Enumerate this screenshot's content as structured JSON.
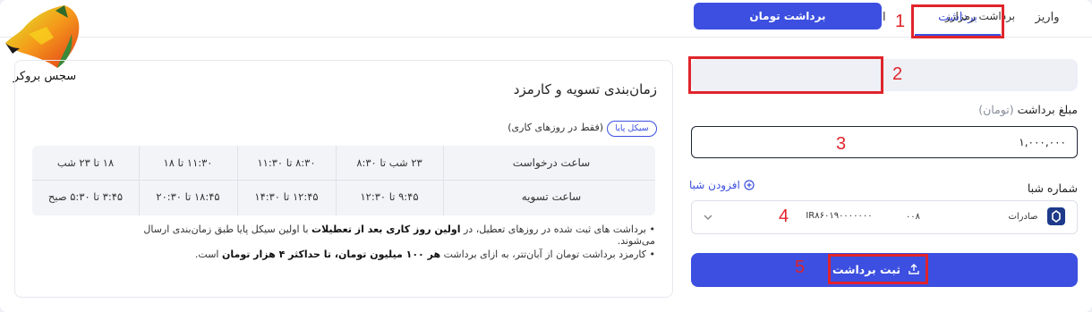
{
  "tabs": {
    "deposit": "واریز",
    "withdraw": "برداشت",
    "transfer": "انتقال"
  },
  "brand": {
    "logo_text": "سجس بروکر"
  },
  "annotations": [
    "1",
    "2",
    "3",
    "4",
    "5"
  ],
  "withdraw_form": {
    "segment_crypto": "برداشت رمزارز",
    "segment_toman": "برداشت تومان",
    "amount_label": "مبلغ برداشت",
    "amount_unit": "(تومان)",
    "amount_value": "۱,۰۰۰,۰۰۰",
    "sheba_label": "شماره شبا",
    "add_sheba": "افزودن شبا",
    "bank_name": "صادرات",
    "sheba_prefix": "۰۰۸",
    "sheba_number": "IR۸۶۰۱۹۰۰۰۰۰۰۰",
    "submit_label": "ثبت برداشت"
  },
  "schedule": {
    "title": "زمان‌بندی تسویه و کارمزد",
    "chip": "سیکل پایا",
    "chip_note": "(فقط در روزهای کاری)",
    "row_request_label": "ساعت درخواست",
    "row_settle_label": "ساعت تسویه",
    "request_times": [
      "۲۳ شب تا ۸:۳۰",
      "۸:۳۰ تا ۱۱:۳۰",
      "۱۱:۳۰ تا ۱۸",
      "۱۸ تا ۲۳ شب"
    ],
    "settle_times": [
      "۹:۴۵ تا ۱۲:۳۰",
      "۱۲:۴۵ تا ۱۴:۳۰",
      "۱۸:۴۵ تا ۲۰:۳۰",
      "۳:۴۵ تا ۵:۳۰ صبح"
    ],
    "note1_a": "برداشت های ثبت شده در روزهای تعطیل، در ",
    "note1_b": "اولین روز کاری بعد از تعطیلات",
    "note1_c": " با اولین سیکل پایا طبق زمان‌بندی ارسال می‌شوند.",
    "note2_a": "کارمزد برداشت تومان از آبان‌تتر، به ازای برداشت ",
    "note2_b": "هر ۱۰۰ میلیون تومان، تا حداکثر ۴ هزار تومان",
    "note2_c": " است."
  },
  "colors": {
    "accent": "#3c4fe0",
    "annotation_red": "#e0242b"
  },
  "icons": [
    "plus-circle-icon",
    "chevron-down-icon",
    "upload-icon",
    "bank-icon",
    "fox-logo-icon"
  ]
}
